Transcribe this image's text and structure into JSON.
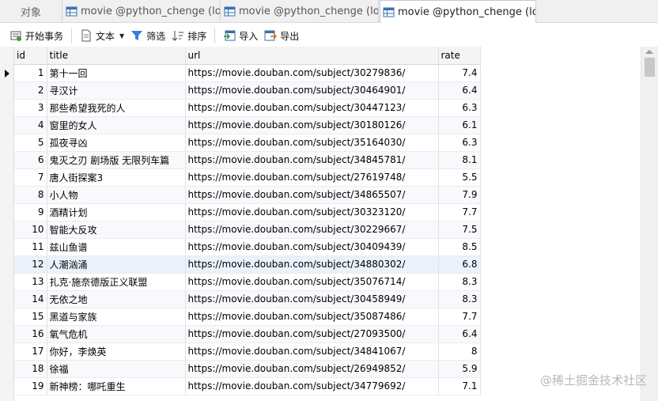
{
  "tabs": {
    "objects_label": "对象",
    "items": [
      {
        "label": "movie @python_chenge (loc..."
      },
      {
        "label": "movie @python_chenge (loc..."
      },
      {
        "label": "movie @python_chenge (loc..."
      }
    ]
  },
  "toolbar": {
    "begin_transaction": "开始事务",
    "text": "文本",
    "filter": "筛选",
    "sort": "排序",
    "import": "导入",
    "export": "导出"
  },
  "grid": {
    "columns": [
      "id",
      "title",
      "url",
      "rate"
    ],
    "rows": [
      {
        "id": "1",
        "title": "第十一回",
        "url": "https://movie.douban.com/subject/30279836/",
        "rate": "7.4"
      },
      {
        "id": "2",
        "title": "寻汉计",
        "url": "https://movie.douban.com/subject/30464901/",
        "rate": "6.4"
      },
      {
        "id": "3",
        "title": "那些希望我死的人",
        "url": "https://movie.douban.com/subject/30447123/",
        "rate": "6.3"
      },
      {
        "id": "4",
        "title": "窗里的女人",
        "url": "https://movie.douban.com/subject/30180126/",
        "rate": "6.1"
      },
      {
        "id": "5",
        "title": "孤夜寻凶",
        "url": "https://movie.douban.com/subject/35164030/",
        "rate": "6.3"
      },
      {
        "id": "6",
        "title": "鬼灭之刃 剧场版 无限列车篇",
        "url": "https://movie.douban.com/subject/34845781/",
        "rate": "8.1"
      },
      {
        "id": "7",
        "title": "唐人街探案3",
        "url": "https://movie.douban.com/subject/27619748/",
        "rate": "5.5"
      },
      {
        "id": "8",
        "title": "小人物",
        "url": "https://movie.douban.com/subject/34865507/",
        "rate": "7.9"
      },
      {
        "id": "9",
        "title": "酒精计划",
        "url": "https://movie.douban.com/subject/30323120/",
        "rate": "7.7"
      },
      {
        "id": "10",
        "title": "智能大反攻",
        "url": "https://movie.douban.com/subject/30229667/",
        "rate": "7.5"
      },
      {
        "id": "11",
        "title": "兹山鱼谱",
        "url": "https://movie.douban.com/subject/30409439/",
        "rate": "8.5"
      },
      {
        "id": "12",
        "title": "人潮汹涌",
        "url": "https://movie.douban.com/subject/34880302/",
        "rate": "6.8"
      },
      {
        "id": "13",
        "title": "扎克·施奈德版正义联盟",
        "url": "https://movie.douban.com/subject/35076714/",
        "rate": "8.3"
      },
      {
        "id": "14",
        "title": "无依之地",
        "url": "https://movie.douban.com/subject/30458949/",
        "rate": "8.3"
      },
      {
        "id": "15",
        "title": "黑道与家族",
        "url": "https://movie.douban.com/subject/35087486/",
        "rate": "7.7"
      },
      {
        "id": "16",
        "title": "氧气危机",
        "url": "https://movie.douban.com/subject/27093500/",
        "rate": "6.4"
      },
      {
        "id": "17",
        "title": "你好，李焕英",
        "url": "https://movie.douban.com/subject/34841067/",
        "rate": "8"
      },
      {
        "id": "18",
        "title": "徐福",
        "url": "https://movie.douban.com/subject/26949852/",
        "rate": "5.9"
      },
      {
        "id": "19",
        "title": "新神榜：哪吒重生",
        "url": "https://movie.douban.com/subject/34779692/",
        "rate": "7.1"
      }
    ]
  },
  "watermark": "@稀土掘金技术社区"
}
